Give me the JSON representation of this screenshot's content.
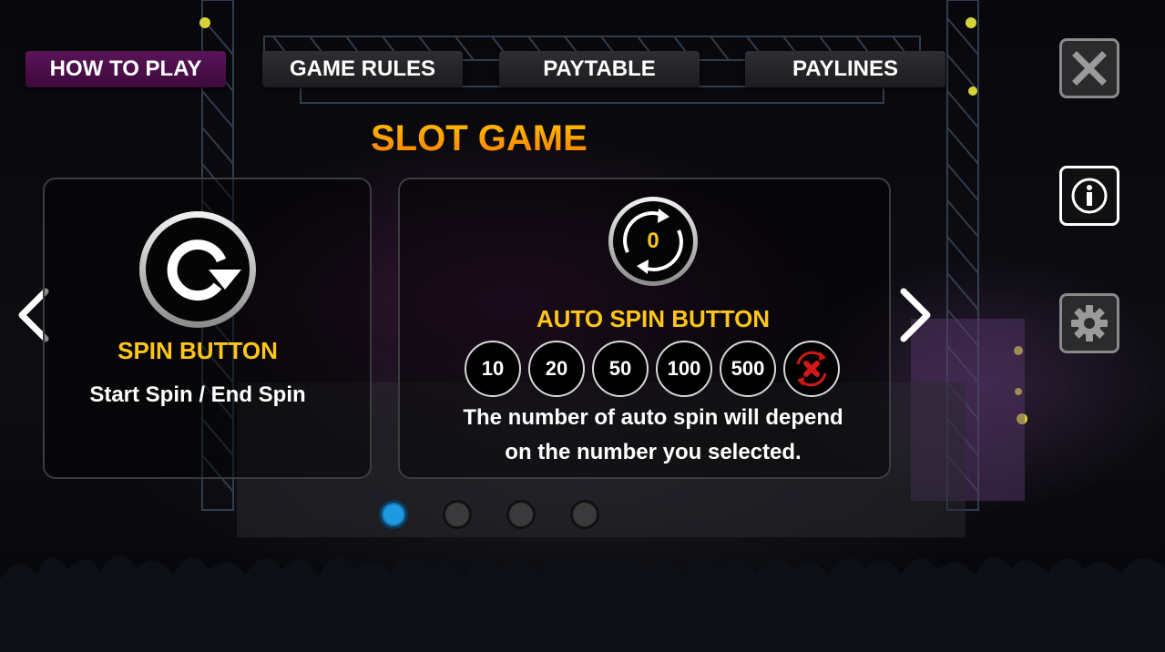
{
  "tabs": [
    {
      "label": "HOW TO PLAY",
      "active": true
    },
    {
      "label": "GAME RULES",
      "active": false
    },
    {
      "label": "PAYTABLE",
      "active": false
    },
    {
      "label": "PAYLINES",
      "active": false
    }
  ],
  "side_buttons": {
    "close": {
      "icon": "close-icon"
    },
    "info": {
      "icon": "info-icon",
      "active": true
    },
    "settings": {
      "icon": "gear-icon"
    }
  },
  "title": "SLOT GAME",
  "spin_panel": {
    "heading": "SPIN BUTTON",
    "description": "Start Spin / End Spin",
    "icon": "spin-icon"
  },
  "auto_spin_panel": {
    "counter": "0",
    "heading": "AUTO SPIN BUTTON",
    "options": [
      "10",
      "20",
      "50",
      "100",
      "500"
    ],
    "cancel_icon": "cancel-icon",
    "description_line1": "The number of auto spin will depend",
    "description_line2": "on the number you selected."
  },
  "pagination": {
    "pages": 4,
    "current": 1
  },
  "colors": {
    "accent_orange": "#ff9a00",
    "heading_yellow": "#ffc61a",
    "active_tab": "#4a0f48",
    "active_dot": "#1e9be0",
    "cancel_red": "#d01818"
  }
}
